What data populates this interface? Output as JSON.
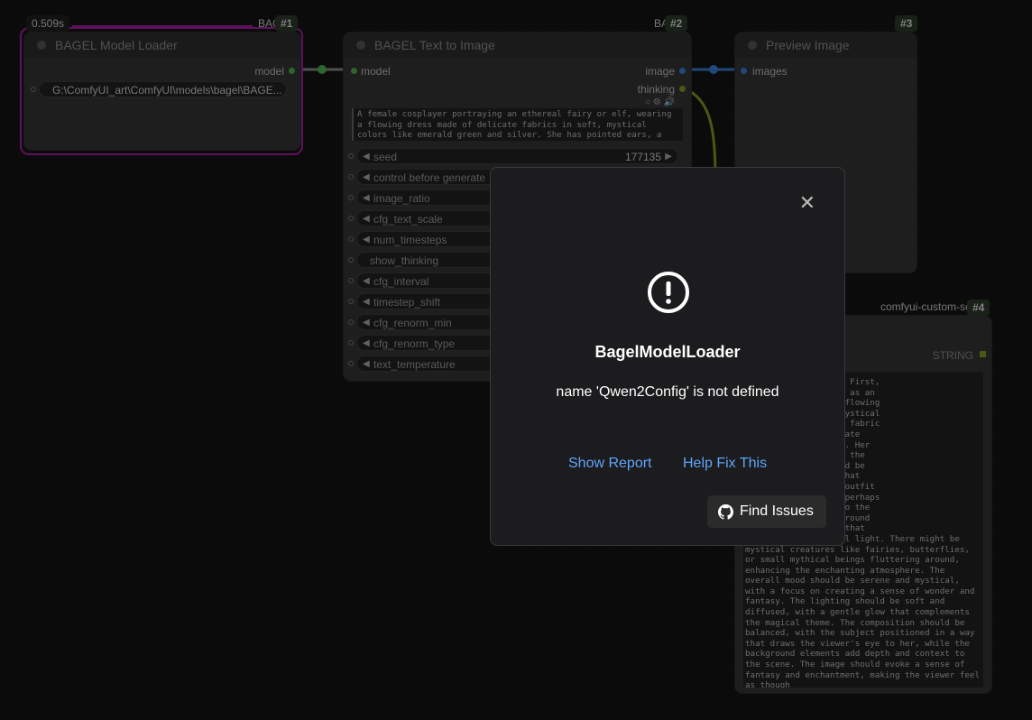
{
  "colors": {
    "accent": "#60a5fa",
    "selection": "#a020a0",
    "model_socket": "#4caf50",
    "image_socket": "#3a7bd5",
    "link_green": "#7a9a20"
  },
  "timing_badge": "0.509s",
  "nodes": {
    "loader": {
      "title": "BAGEL Model Loader",
      "type_label": "BAG",
      "id": "#1",
      "output": "model",
      "path_value": "G:\\ComfyUI_art\\ComfyUI\\models\\bagel\\BAGE..."
    },
    "t2i": {
      "title": "BAGEL Text to Image",
      "type_label": "BAC",
      "id": "#2",
      "input": "model",
      "outputs": [
        "image",
        "thinking"
      ],
      "prompt": "A female cosplayer portraying an ethereal fairy or elf, wearing a flowing dress made of delicate fabrics in soft, mystical colors like emerald green and silver. She has pointed ears, a gentle,",
      "widgets": [
        {
          "label": "seed",
          "value": "177135",
          "arrows": true
        },
        {
          "label": "control before generate",
          "value": "",
          "arrows": true
        },
        {
          "label": "image_ratio",
          "value": "",
          "arrows": true
        },
        {
          "label": "cfg_text_scale",
          "value": "",
          "arrows": true
        },
        {
          "label": "num_timesteps",
          "value": "",
          "arrows": true
        },
        {
          "label": "show_thinking",
          "value": "",
          "arrows": false
        },
        {
          "label": "cfg_interval",
          "value": "",
          "arrows": true
        },
        {
          "label": "timestep_shift",
          "value": "",
          "arrows": true
        },
        {
          "label": "cfg_renorm_min",
          "value": "",
          "arrows": true
        },
        {
          "label": "cfg_renorm_type",
          "value": "",
          "arrows": true
        },
        {
          "label": "text_temperature",
          "value": "",
          "arrows": true
        }
      ]
    },
    "preview": {
      "title": "Preview Image",
      "id": "#3",
      "input": "images"
    },
    "show": {
      "type_label": "comfyui-custom-sc",
      "id": "#4",
      "output": "STRING",
      "text": "this vision to life. First,\nle cosplayer dressed as an\n. She should have a flowing\ne fabrics in soft, mystical\nreen and silver. The fabric\nnd airy, with intricate\n and catch the light. Her\ny feature, adding to the\nHer expression should be\n, with a soft gaze that\nnder and magic. The outfit\nh sparkling jewels, perhaps\nnd emerald, adding to the\nldly feel. The background\nwith glowing plants that\nemit a soft, ethereal light. There might be mystical creatures like fairies, butterflies, or small mythical beings fluttering around, enhancing the enchanting atmosphere. The overall mood should be serene and mystical, with a focus on creating a sense of wonder and fantasy. The lighting should be soft and diffused, with a gentle glow that complements the magical theme. The composition should be balanced, with the subject positioned in a way that draws the viewer's eye to her, while the background elements add depth and context to the scene. The image should evoke a sense of fantasy and enchantment, making the viewer feel as though"
    }
  },
  "dialog": {
    "title": "BagelModelLoader",
    "message": "name 'Qwen2Config' is not defined",
    "show_report": "Show Report",
    "help_fix": "Help Fix This",
    "find_issues": "Find Issues"
  }
}
